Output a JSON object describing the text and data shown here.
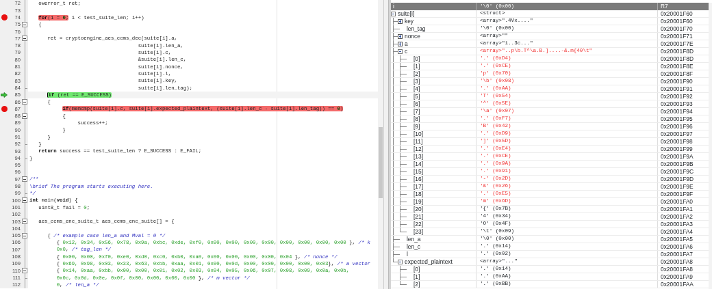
{
  "editor": {
    "lines": [
      {
        "n": "72",
        "kind": "plain",
        "breakpoint": false,
        "current": false,
        "segs": [
          {
            "text": "   owerror_t ret;",
            "kind": "code"
          }
        ]
      },
      {
        "n": "73",
        "kind": "plain",
        "breakpoint": false,
        "current": false
      },
      {
        "n": "74",
        "kind": "plain",
        "breakpoint": true,
        "current": false,
        "highlighted": [
          {
            "text": "   for",
            "kind": "kw"
          },
          {
            "text": "(i = ",
            "kind": "code"
          },
          {
            "text": "0",
            "kind": "num"
          },
          {
            "text": ";",
            "kind": "code"
          }
        ],
        "after": [
          {
            "text": " i < test_suite_len; i++)",
            "kind": "code"
          }
        ]
      },
      {
        "n": "75",
        "kind": "start",
        "breakpoint": false,
        "current": false,
        "segs": [
          {
            "text": "   {",
            "kind": "code"
          }
        ]
      },
      {
        "n": "76",
        "kind": "plain",
        "breakpoint": false,
        "current": false
      },
      {
        "n": "77",
        "kind": "start",
        "breakpoint": false,
        "current": false,
        "segs": [
          {
            "text": "      ret = cryptoengine_aes_ccms_dec(suite[i].a,",
            "kind": "code"
          }
        ]
      },
      {
        "n": "78",
        "kind": "plain",
        "breakpoint": false,
        "current": false,
        "segs": [
          {
            "text": "                                    suite[i].len_a,",
            "kind": "code"
          }
        ]
      },
      {
        "n": "79",
        "kind": "plain",
        "breakpoint": false,
        "current": false,
        "segs": [
          {
            "text": "                                    suite[i].c,",
            "kind": "code"
          }
        ]
      },
      {
        "n": "80",
        "kind": "plain",
        "breakpoint": false,
        "current": false,
        "segs": [
          {
            "text": "                                    &suite[i].len_c,",
            "kind": "code"
          }
        ]
      },
      {
        "n": "81",
        "kind": "plain",
        "breakpoint": false,
        "current": false,
        "segs": [
          {
            "text": "                                    suite[i].nonce,",
            "kind": "code"
          }
        ]
      },
      {
        "n": "82",
        "kind": "plain",
        "breakpoint": false,
        "current": false,
        "segs": [
          {
            "text": "                                    suite[i].l,",
            "kind": "code"
          }
        ]
      },
      {
        "n": "83",
        "kind": "plain",
        "breakpoint": false,
        "current": false,
        "segs": [
          {
            "text": "                                    suite[i].key,",
            "kind": "code"
          }
        ]
      },
      {
        "n": "84",
        "kind": "end",
        "breakpoint": false,
        "current": false,
        "segs": [
          {
            "text": "                                    suite[i].len_tag);",
            "kind": "code"
          }
        ]
      },
      {
        "n": "85",
        "kind": "plain",
        "breakpoint": false,
        "current": true,
        "highlighted": [
          {
            "text": "      if",
            "kind": "kw"
          },
          {
            "text": " (ret == E_SUCCESS)",
            "kind": "code"
          }
        ]
      },
      {
        "n": "86",
        "kind": "start",
        "breakpoint": false,
        "current": false,
        "segs": [
          {
            "text": "      {",
            "kind": "code"
          }
        ]
      },
      {
        "n": "87",
        "kind": "plain",
        "breakpoint": true,
        "current": false,
        "highlighted": [
          {
            "text": "           if",
            "kind": "kw"
          },
          {
            "text": "(memcmp(suite[i].c, suite[i].expected_plaintext, (suite[i].len_c - suite[i].len_tag)) == ",
            "kind": "code"
          },
          {
            "text": "0",
            "kind": "num"
          },
          {
            "text": ")",
            "kind": "code"
          }
        ]
      },
      {
        "n": "88",
        "kind": "start",
        "breakpoint": false,
        "current": false,
        "segs": [
          {
            "text": "           {",
            "kind": "code"
          }
        ]
      },
      {
        "n": "89",
        "kind": "plain",
        "breakpoint": false,
        "current": false,
        "segs": [
          {
            "text": "                success++;",
            "kind": "code"
          }
        ]
      },
      {
        "n": "90",
        "kind": "plain",
        "breakpoint": false,
        "current": false,
        "segs": [
          {
            "text": "           }",
            "kind": "code"
          }
        ]
      },
      {
        "n": "91",
        "kind": "plain",
        "breakpoint": false,
        "current": false,
        "segs": [
          {
            "text": "      }",
            "kind": "code"
          }
        ]
      },
      {
        "n": "92",
        "kind": "end",
        "breakpoint": false,
        "current": false,
        "segs": [
          {
            "text": "   }",
            "kind": "code"
          }
        ]
      },
      {
        "n": "93",
        "kind": "plain",
        "breakpoint": false,
        "current": false,
        "segs": [
          {
            "text": "   return",
            "kind": "kw"
          },
          {
            "text": " success == test_suite_len ? E_SUCCESS : E_FAIL;",
            "kind": "code"
          }
        ]
      },
      {
        "n": "94",
        "kind": "end",
        "breakpoint": false,
        "current": false,
        "segs": [
          {
            "text": "}",
            "kind": "code"
          }
        ]
      },
      {
        "n": "95",
        "kind": "plain",
        "breakpoint": false,
        "current": false
      },
      {
        "n": "96",
        "kind": "plain",
        "breakpoint": false,
        "current": false
      },
      {
        "n": "97",
        "kind": "start",
        "breakpoint": false,
        "current": false,
        "segs": [
          {
            "text": "/**",
            "kind": "comment"
          }
        ]
      },
      {
        "n": "98",
        "kind": "plain",
        "breakpoint": false,
        "current": false,
        "segs": [
          {
            "text": "\\brief The program starts executing here.",
            "kind": "comment"
          }
        ]
      },
      {
        "n": "99",
        "kind": "end",
        "breakpoint": false,
        "current": false,
        "segs": [
          {
            "text": "*/",
            "kind": "comment"
          }
        ]
      },
      {
        "n": "100",
        "kind": "start",
        "breakpoint": false,
        "current": false,
        "segs": [
          {
            "text": "int",
            "kind": "kw"
          },
          {
            "text": " main(",
            "kind": "code"
          },
          {
            "text": "void",
            "kind": "kw"
          },
          {
            "text": ") {",
            "kind": "code"
          }
        ]
      },
      {
        "n": "101",
        "kind": "plain",
        "breakpoint": false,
        "current": false,
        "segs": [
          {
            "text": "   uint8_t fail = ",
            "kind": "code"
          },
          {
            "text": "0",
            "kind": "num"
          },
          {
            "text": ";",
            "kind": "code"
          }
        ]
      },
      {
        "n": "102",
        "kind": "plain",
        "breakpoint": false,
        "current": false
      },
      {
        "n": "103",
        "kind": "start",
        "breakpoint": false,
        "current": false,
        "segs": [
          {
            "text": "   aes_ccms_enc_suite_t aes_ccms_enc_suite[] = {",
            "kind": "code"
          }
        ]
      },
      {
        "n": "104",
        "kind": "plain",
        "breakpoint": false,
        "current": false
      },
      {
        "n": "105",
        "kind": "start",
        "breakpoint": false,
        "current": false,
        "segs": [
          {
            "text": "      { ",
            "kind": "code"
          },
          {
            "text": "/* example case len_a and Mval = 0 */",
            "kind": "comment"
          }
        ]
      },
      {
        "n": "106",
        "kind": "plain",
        "breakpoint": false,
        "current": false,
        "segs": [
          {
            "text": "         { ",
            "kind": "code"
          },
          {
            "text": "0x12, 0x34, 0x56, 0x78, 0x9a, 0xbc, 0xde, 0xf0, 0x00, 0x00, 0x00, 0x00, 0x00, 0x00, 0x00, 0x00",
            "kind": "num"
          },
          {
            "text": " }, ",
            "kind": "code"
          },
          {
            "text": "/* k",
            "kind": "comment"
          }
        ]
      },
      {
        "n": "107",
        "kind": "plain",
        "breakpoint": false,
        "current": false,
        "segs": [
          {
            "text": "         0x0",
            "kind": "num"
          },
          {
            "text": ", ",
            "kind": "code"
          },
          {
            "text": "/* tag_len */",
            "kind": "comment"
          }
        ]
      },
      {
        "n": "108",
        "kind": "plain",
        "breakpoint": false,
        "current": false,
        "segs": [
          {
            "text": "         { ",
            "kind": "code"
          },
          {
            "text": "0x00, 0x00, 0xf0, 0xe0, 0xd0, 0xc0, 0xb0, 0xa0, 0x00, 0x00, 0x00, 0x00, 0x04",
            "kind": "num"
          },
          {
            "text": " }, ",
            "kind": "code"
          },
          {
            "text": "/* nonce */",
            "kind": "comment"
          }
        ]
      },
      {
        "n": "109",
        "kind": "plain",
        "breakpoint": false,
        "current": false,
        "segs": [
          {
            "text": "         { ",
            "kind": "code"
          },
          {
            "text": "0x69, 0x98, 0x03, 0x33, 0x63, 0xbb, 0xaa, 0x01, 0x00, 0x0d, 0x00, 0x00, 0x00, 0x00, 0x03",
            "kind": "num"
          },
          {
            "text": "}, ",
            "kind": "code"
          },
          {
            "text": "/* a vector",
            "kind": "comment"
          }
        ]
      },
      {
        "n": "110",
        "kind": "start",
        "breakpoint": false,
        "current": false,
        "segs": [
          {
            "text": "         { ",
            "kind": "code"
          },
          {
            "text": "0x14, 0xaa, 0xbb, 0x00, 0x00, 0x01, 0x02, 0x03, 0x04, 0x05, 0x06, 0x07, 0x08, 0x09, 0x0a, 0x0b,",
            "kind": "num"
          }
        ]
      },
      {
        "n": "111",
        "kind": "end",
        "breakpoint": false,
        "current": false,
        "segs": [
          {
            "text": "         0x0c, 0x0d, 0x0e, 0x0f, 0x00, 0x00, 0x00, 0x00",
            "kind": "num"
          },
          {
            "text": " }, ",
            "kind": "code"
          },
          {
            "text": "/* m vector */",
            "kind": "comment"
          }
        ]
      },
      {
        "n": "112",
        "kind": "plain",
        "breakpoint": false,
        "current": false,
        "segs": [
          {
            "text": "         0",
            "kind": "num"
          },
          {
            "text": ", ",
            "kind": "code"
          },
          {
            "text": "/* len_a */",
            "kind": "comment"
          }
        ]
      }
    ]
  },
  "watch": {
    "header": {
      "name": "i",
      "value": "'\\0' (0x00)",
      "location": "R7"
    },
    "rows": [
      {
        "name": "suite[i]",
        "value": "<struct>",
        "location": "0x20001F60",
        "changed": false,
        "expanded": true,
        "children": [
          {
            "name": "key",
            "value": "<array>\".4Vx....\"",
            "location": "0x20001F60",
            "changed": false,
            "expanded": false
          },
          {
            "name": "len_tag",
            "value": "'\\0' (0x00)",
            "location": "0x20001F70",
            "changed": false
          },
          {
            "name": "nonce",
            "value": "<array>\"\"",
            "location": "0x20001F71",
            "changed": false,
            "expanded": false
          },
          {
            "name": "a",
            "value": "<array>\"i..3c...\"",
            "location": "0x20001F7E",
            "changed": false,
            "expanded": false
          },
          {
            "name": "c",
            "value": "<array>\"..p\\b.T^\\a.B.]....-&.m{40\\t\"",
            "location": "0x20001F8D",
            "changed": true,
            "expanded": true,
            "children": [
              {
                "name": "[0]",
                "value": "'.' (0xD4)",
                "location": "0x20001F8D",
                "changed": true
              },
              {
                "name": "[1]",
                "value": "'.' (0xCE)",
                "location": "0x20001F8E",
                "changed": true
              },
              {
                "name": "[2]",
                "value": "'p' (0x70)",
                "location": "0x20001F8F",
                "changed": true
              },
              {
                "name": "[3]",
                "value": "'\\b' (0x08)",
                "location": "0x20001F90",
                "changed": true
              },
              {
                "name": "[4]",
                "value": "'.' (0xAA)",
                "location": "0x20001F91",
                "changed": true
              },
              {
                "name": "[5]",
                "value": "'T' (0x54)",
                "location": "0x20001F92",
                "changed": true
              },
              {
                "name": "[6]",
                "value": "'^' (0x5E)",
                "location": "0x20001F93",
                "changed": true
              },
              {
                "name": "[7]",
                "value": "'\\a' (0x07)",
                "location": "0x20001F94",
                "changed": true
              },
              {
                "name": "[8]",
                "value": "'.' (0xF7)",
                "location": "0x20001F95",
                "changed": true
              },
              {
                "name": "[9]",
                "value": "'B' (0x42)",
                "location": "0x20001F96",
                "changed": true
              },
              {
                "name": "[10]",
                "value": "'.' (0xD9)",
                "location": "0x20001F97",
                "changed": true
              },
              {
                "name": "[11]",
                "value": "']' (0x5D)",
                "location": "0x20001F98",
                "changed": true
              },
              {
                "name": "[12]",
                "value": "'.' (0xE4)",
                "location": "0x20001F99",
                "changed": true
              },
              {
                "name": "[13]",
                "value": "'.' (0xCE)",
                "location": "0x20001F9A",
                "changed": true
              },
              {
                "name": "[14]",
                "value": "'.' (0x9A)",
                "location": "0x20001F9B",
                "changed": true
              },
              {
                "name": "[15]",
                "value": "'.' (0x91)",
                "location": "0x20001F9C",
                "changed": true
              },
              {
                "name": "[16]",
                "value": "'-' (0x2D)",
                "location": "0x20001F9D",
                "changed": true
              },
              {
                "name": "[17]",
                "value": "'&' (0x26)",
                "location": "0x20001F9E",
                "changed": true
              },
              {
                "name": "[18]",
                "value": "'.' (0xE5)",
                "location": "0x20001F9F",
                "changed": true
              },
              {
                "name": "[19]",
                "value": "'m' (0x6D)",
                "location": "0x20001FA0",
                "changed": true
              },
              {
                "name": "[20]",
                "value": "'{' (0x7B)",
                "location": "0x20001FA1",
                "changed": false
              },
              {
                "name": "[21]",
                "value": "'4' (0x34)",
                "location": "0x20001FA2",
                "changed": false
              },
              {
                "name": "[22]",
                "value": "'O' (0x4F)",
                "location": "0x20001FA3",
                "changed": false
              },
              {
                "name": "[23]",
                "value": "'\\t' (0x09)",
                "location": "0x20001FA4",
                "changed": false
              }
            ]
          },
          {
            "name": "len_a",
            "value": "'\\0' (0x00)",
            "location": "0x20001FA5",
            "changed": false
          },
          {
            "name": "len_c",
            "value": "'.' (0x14)",
            "location": "0x20001FA6",
            "changed": false
          },
          {
            "name": "l",
            "value": "'.' (0x02)",
            "location": "0x20001FA7",
            "changed": false
          },
          {
            "name": "expected_plaintext",
            "value": "<array>\"...\"",
            "location": "0x20001FA8",
            "changed": false,
            "expanded": true,
            "children": [
              {
                "name": "[0]",
                "value": "'.' (0x14)",
                "location": "0x20001FA8",
                "changed": false
              },
              {
                "name": "[1]",
                "value": "'.' (0xAA)",
                "location": "0x20001FA9",
                "changed": false
              },
              {
                "name": "[2]",
                "value": "'.' (0xBB)",
                "location": "0x20001FAA",
                "changed": false
              }
            ]
          }
        ]
      }
    ]
  }
}
